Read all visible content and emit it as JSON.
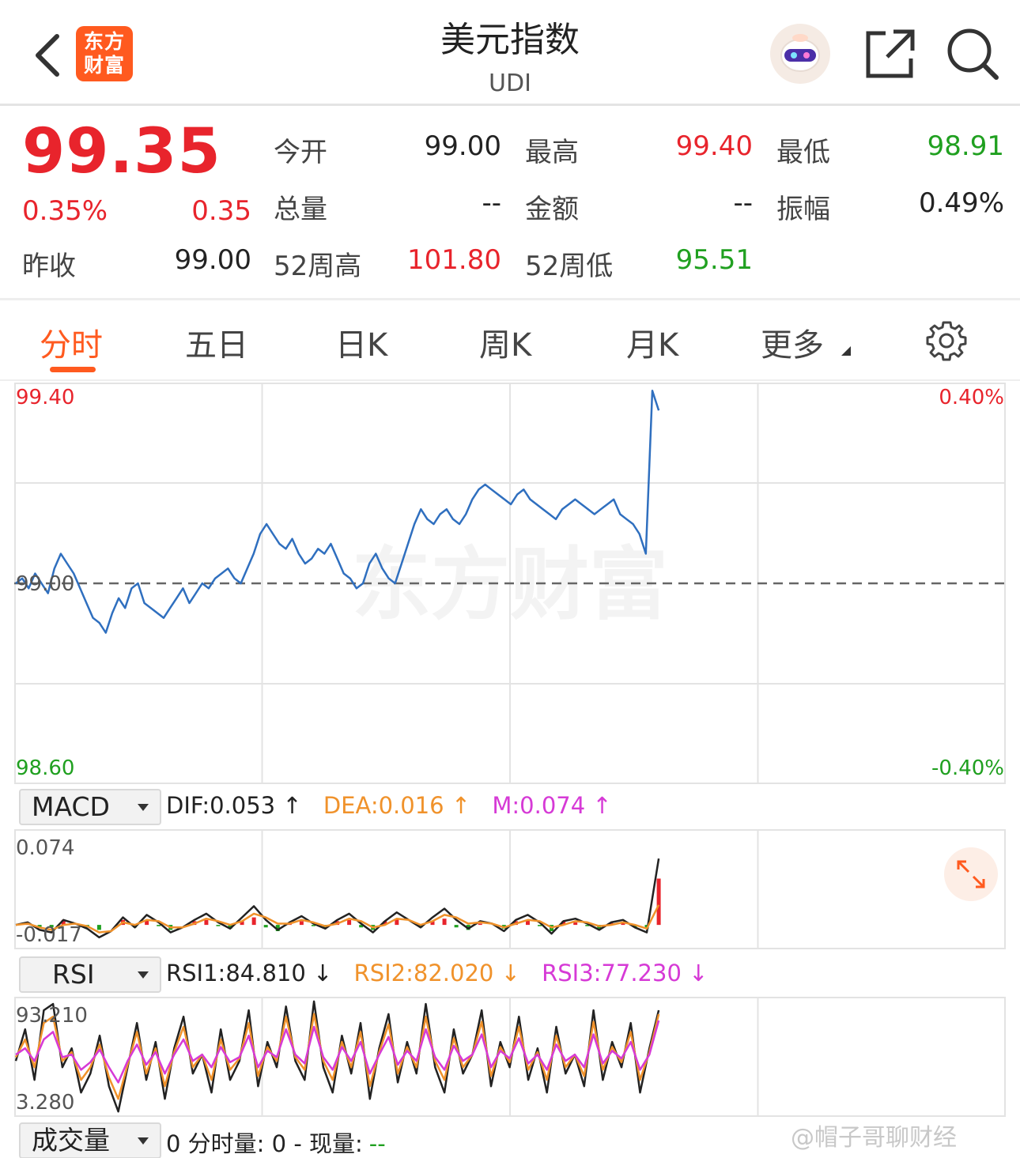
{
  "header": {
    "logo_line1": "东方",
    "logo_line2": "财富",
    "title": "美元指数",
    "subtitle": "UDI"
  },
  "quote": {
    "price": "99.35",
    "change_pct": "0.35%",
    "change": "0.35",
    "prev_close_label": "昨收",
    "prev_close": "99.00",
    "fields": [
      {
        "label": "今开",
        "value": "99.00",
        "color": "dark"
      },
      {
        "label": "最高",
        "value": "99.40",
        "color": "red"
      },
      {
        "label": "最低",
        "value": "98.91",
        "color": "green"
      },
      {
        "label": "总量",
        "value": "--",
        "color": "dark"
      },
      {
        "label": "金额",
        "value": "--",
        "color": "dark"
      },
      {
        "label": "振幅",
        "value": "0.49%",
        "color": "dark"
      },
      {
        "label": "52周高",
        "value": "101.80",
        "color": "red"
      },
      {
        "label": "52周低",
        "value": "95.51",
        "color": "green"
      }
    ]
  },
  "tabs": [
    {
      "label": "分时",
      "active": true
    },
    {
      "label": "五日",
      "active": false
    },
    {
      "label": "日K",
      "active": false
    },
    {
      "label": "周K",
      "active": false
    },
    {
      "label": "月K",
      "active": false
    },
    {
      "label": "更多",
      "active": false
    }
  ],
  "colors": {
    "up": "#e8242c",
    "down": "#20a020",
    "price_line": "#2f6fbf",
    "accent": "#ff5a1f",
    "dea": "#f0922b",
    "m": "#d63ad6"
  },
  "chart_data": [
    {
      "type": "line",
      "name": "intraday",
      "title": "",
      "ylim": [
        98.6,
        99.4
      ],
      "y_labels_left": [
        "99.40",
        "99.00",
        "98.60"
      ],
      "y_labels_right": [
        "0.40%",
        "-0.40%"
      ],
      "baseline": 99.0,
      "watermark": "东方财富",
      "session_fraction": 0.65,
      "series": [
        {
          "values": [
            99.0,
            99.01,
            98.99,
            99.02,
            99.0,
            98.98,
            99.03,
            99.06,
            99.04,
            99.02,
            98.99,
            98.96,
            98.93,
            98.92,
            98.9,
            98.94,
            98.97,
            98.95,
            98.99,
            99.0,
            98.96,
            98.95,
            98.94,
            98.93,
            98.95,
            98.97,
            98.99,
            98.96,
            98.98,
            99.0,
            98.99,
            99.01,
            99.02,
            99.03,
            99.01,
            99.0,
            99.03,
            99.06,
            99.1,
            99.12,
            99.1,
            99.08,
            99.07,
            99.09,
            99.06,
            99.04,
            99.05,
            99.07,
            99.06,
            99.08,
            99.05,
            99.02,
            99.01,
            98.99,
            99.0,
            99.04,
            99.06,
            99.03,
            99.01,
            99.0,
            99.04,
            99.08,
            99.12,
            99.15,
            99.13,
            99.12,
            99.14,
            99.15,
            99.13,
            99.12,
            99.14,
            99.17,
            99.19,
            99.2,
            99.19,
            99.18,
            99.17,
            99.16,
            99.18,
            99.19,
            99.17,
            99.16,
            99.15,
            99.14,
            99.13,
            99.15,
            99.16,
            99.17,
            99.16,
            99.15,
            99.14,
            99.15,
            99.16,
            99.17,
            99.14,
            99.13,
            99.12,
            99.1,
            99.06,
            99.39,
            99.35
          ]
        }
      ]
    },
    {
      "type": "line",
      "name": "macd",
      "indicator": "MACD",
      "ylim": [
        -0.017,
        0.074
      ],
      "y_labels": [
        "0.074",
        "-0.017"
      ],
      "legend": [
        {
          "text": "DIF:0.053 ↑",
          "color": "#222222"
        },
        {
          "text": "DEA:0.016 ↑",
          "color": "#f0922b"
        },
        {
          "text": "M:0.074 ↑",
          "color": "#d63ad6"
        }
      ],
      "series": [
        {
          "name": "DIF",
          "values": [
            0.0,
            0.002,
            -0.004,
            -0.006,
            0.004,
            0.001,
            -0.003,
            -0.01,
            -0.005,
            0.006,
            -0.002,
            0.008,
            0.002,
            -0.006,
            -0.002,
            0.004,
            0.009,
            0.002,
            -0.003,
            0.006,
            0.015,
            0.004,
            -0.004,
            0.002,
            0.007,
            0.001,
            -0.003,
            0.004,
            0.009,
            0.001,
            -0.006,
            0.003,
            0.01,
            0.004,
            -0.002,
            0.006,
            0.013,
            0.004,
            -0.003,
            0.003,
            0.001,
            -0.005,
            0.004,
            0.008,
            0.002,
            -0.007,
            0.003,
            0.005,
            0.001,
            -0.004,
            0.002,
            0.004,
            -0.002,
            -0.006,
            0.053
          ]
        },
        {
          "name": "DEA",
          "values": [
            0.0,
            0.001,
            -0.002,
            -0.004,
            0.0,
            0.001,
            -0.001,
            -0.006,
            -0.005,
            0.002,
            0.0,
            0.004,
            0.003,
            -0.002,
            -0.002,
            0.001,
            0.005,
            0.003,
            0.0,
            0.003,
            0.009,
            0.006,
            0.001,
            0.001,
            0.004,
            0.002,
            -0.001,
            0.001,
            0.005,
            0.003,
            -0.002,
            0.0,
            0.005,
            0.004,
            0.0,
            0.003,
            0.008,
            0.006,
            0.001,
            0.002,
            0.001,
            -0.002,
            0.001,
            0.004,
            0.003,
            -0.002,
            0.0,
            0.003,
            0.002,
            -0.001,
            0.0,
            0.002,
            0.0,
            -0.003,
            0.016
          ]
        }
      ]
    },
    {
      "type": "line",
      "name": "rsi",
      "indicator": "RSI",
      "ylim": [
        3.28,
        93.21
      ],
      "y_labels": [
        "93.210",
        "3.280"
      ],
      "legend": [
        {
          "text": "RSI1:84.810 ↓",
          "color": "#222222"
        },
        {
          "text": "RSI2:82.020 ↓",
          "color": "#f0922b"
        },
        {
          "text": "RSI3:77.230 ↓",
          "color": "#d63ad6"
        }
      ],
      "series": [
        {
          "name": "RSI1",
          "values": [
            45,
            70,
            30,
            85,
            90,
            40,
            55,
            20,
            35,
            65,
            25,
            5,
            40,
            75,
            30,
            60,
            15,
            55,
            80,
            35,
            50,
            20,
            70,
            30,
            45,
            85,
            25,
            60,
            40,
            88,
            45,
            30,
            92,
            40,
            20,
            65,
            35,
            75,
            15,
            55,
            82,
            28,
            60,
            35,
            90,
            40,
            20,
            70,
            35,
            50,
            85,
            25,
            60,
            40,
            80,
            30,
            55,
            20,
            72,
            35,
            50,
            25,
            85,
            30,
            60,
            40,
            75,
            20,
            55,
            85
          ]
        },
        {
          "name": "RSI2",
          "values": [
            48,
            62,
            40,
            75,
            80,
            45,
            52,
            30,
            40,
            58,
            32,
            15,
            42,
            68,
            35,
            55,
            25,
            52,
            72,
            40,
            50,
            30,
            62,
            38,
            47,
            75,
            33,
            56,
            45,
            80,
            48,
            38,
            82,
            45,
            30,
            60,
            40,
            68,
            25,
            52,
            74,
            35,
            56,
            40,
            80,
            45,
            30,
            63,
            40,
            50,
            76,
            33,
            56,
            44,
            72,
            38,
            52,
            30,
            65,
            40,
            50,
            33,
            76,
            38,
            56,
            44,
            68,
            30,
            52,
            82
          ]
        },
        {
          "name": "RSI3",
          "values": [
            50,
            55,
            45,
            62,
            68,
            48,
            50,
            38,
            44,
            54,
            40,
            28,
            45,
            58,
            42,
            52,
            35,
            50,
            62,
            45,
            50,
            40,
            56,
            44,
            48,
            65,
            40,
            53,
            48,
            70,
            50,
            43,
            72,
            48,
            38,
            56,
            45,
            60,
            35,
            50,
            64,
            42,
            53,
            45,
            70,
            48,
            38,
            57,
            45,
            50,
            66,
            40,
            53,
            47,
            63,
            43,
            50,
            38,
            58,
            45,
            50,
            40,
            66,
            43,
            53,
            47,
            60,
            38,
            50,
            77
          ]
        }
      ]
    }
  ],
  "volume": {
    "indicator": "成交量",
    "text1": "0 分时量: 0 - 现量:",
    "text2": "--"
  },
  "watermark_text": "@帽子哥聊财经"
}
